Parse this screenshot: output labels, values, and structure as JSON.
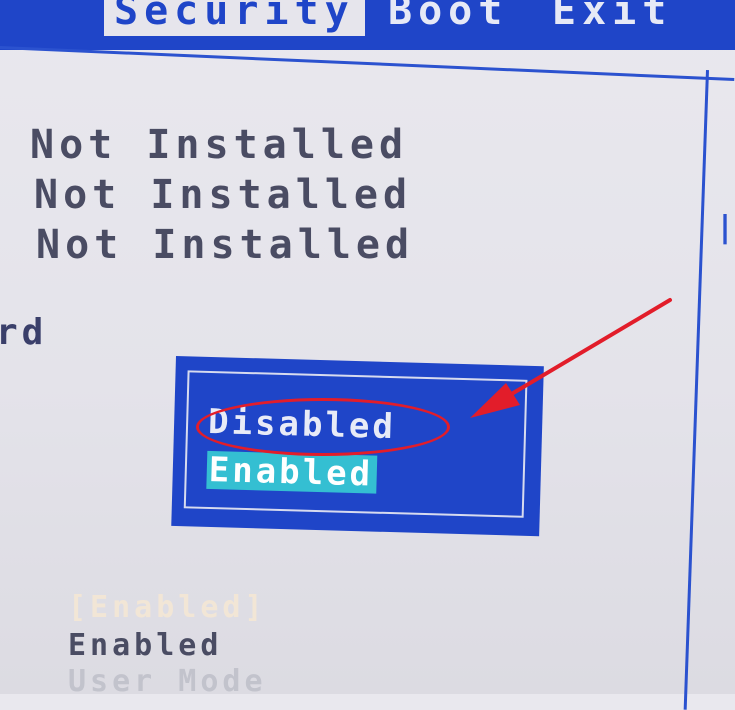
{
  "tabs": [
    {
      "label": "Security",
      "active": true
    },
    {
      "label": "Boot",
      "active": false
    },
    {
      "label": "Exit",
      "active": false
    }
  ],
  "status_values": [
    "Not Installed",
    "Not Installed",
    "Not Installed"
  ],
  "partial_label": "rd",
  "popup": {
    "options": [
      "Disabled",
      "Enabled"
    ],
    "selected": "Enabled"
  },
  "bottom_items": [
    "[Enabled]",
    "Enabled",
    "User Mode"
  ],
  "colors": {
    "bios_blue": "#1f45c8",
    "background": "#e6e5ec",
    "highlight": "#34bfd2",
    "annotation_red": "#e21d2a"
  },
  "icons": [
    "arrow-annotation-icon"
  ]
}
